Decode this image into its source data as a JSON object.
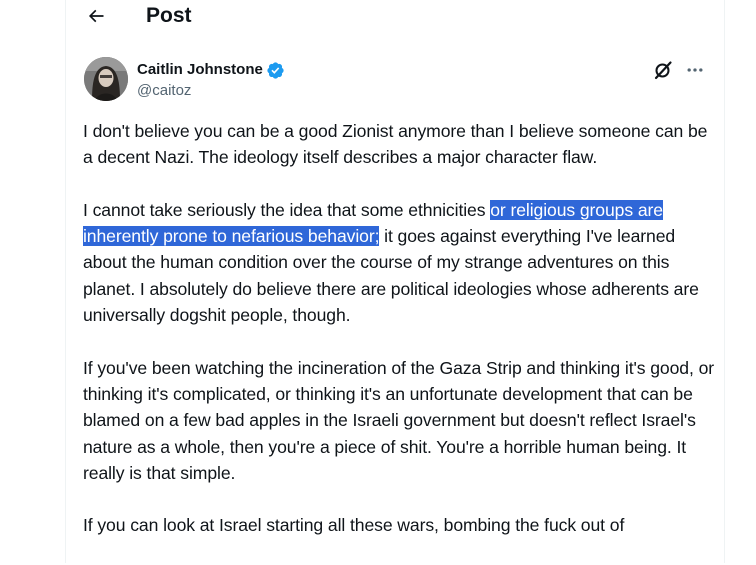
{
  "header": {
    "title": "Post"
  },
  "author": {
    "display_name": "Caitlin Johnstone",
    "handle": "@caitoz",
    "verified": true
  },
  "icons": {
    "back": "arrow-left-icon",
    "verified": "verified-badge-icon",
    "grok": "grok-icon",
    "more": "more-horizontal-icon"
  },
  "colors": {
    "text": "#0f1419",
    "secondary": "#536471",
    "verified_blue": "#1d9bf0",
    "highlight": "#2f67d8"
  },
  "post": {
    "p1": "I don't believe you can be a good Zionist anymore than I believe someone can be a decent Nazi. The ideology itself describes a major character flaw.",
    "p2_before": "I cannot take seriously the idea that some ethnicities ",
    "p2_highlight": "or religious groups are inherently prone to nefarious behavior;",
    "p2_after": " it goes against everything I've learned about the human condition over the course of my strange adventures on this planet. I absolutely do believe there are political ideologies whose adherents are universally dogshit people, though.",
    "p3": "If you've been watching the incineration of the Gaza Strip and thinking it's good, or thinking it's complicated, or thinking it's an unfortunate development that can be blamed on a few bad apples in the Israeli government but doesn't reflect Israel's nature as a whole, then you're a piece of shit. You're a horrible human being. It really is that simple.",
    "p4": "If you can look at Israel starting all these wars, bombing the fuck out of"
  }
}
